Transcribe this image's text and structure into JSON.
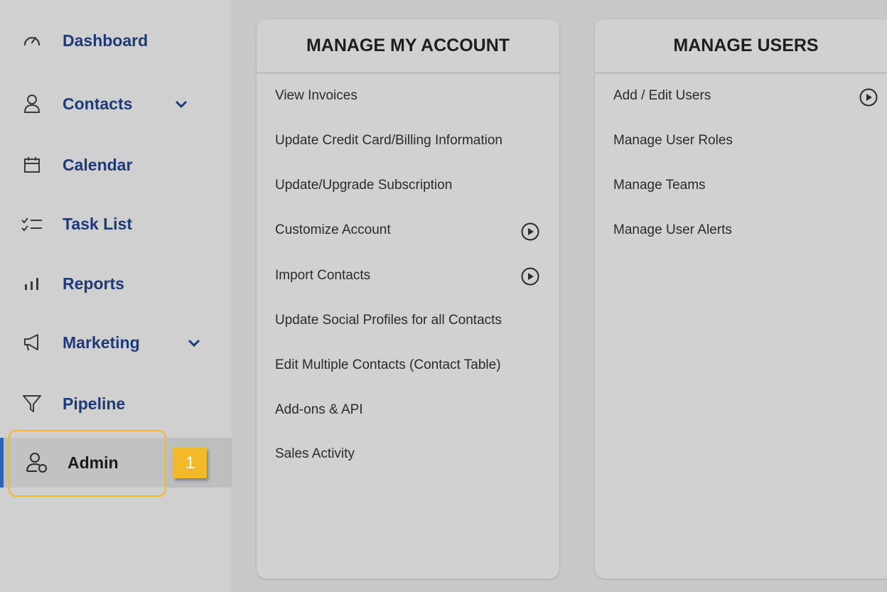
{
  "sidebar": {
    "items": [
      {
        "label": "Dashboard",
        "icon": "gauge-icon"
      },
      {
        "label": "Contacts",
        "icon": "person-icon",
        "has_dropdown": true
      },
      {
        "label": "Calendar",
        "icon": "calendar-icon"
      },
      {
        "label": "Task List",
        "icon": "checklist-icon"
      },
      {
        "label": "Reports",
        "icon": "bar-chart-icon"
      },
      {
        "label": "Marketing",
        "icon": "megaphone-icon",
        "has_dropdown": true
      },
      {
        "label": "Pipeline",
        "icon": "funnel-icon"
      },
      {
        "label": "Admin",
        "icon": "user-shield-icon",
        "active": true
      }
    ]
  },
  "step_badge": "1",
  "cards": {
    "account": {
      "title": "MANAGE MY ACCOUNT",
      "items": [
        {
          "label": "View Invoices"
        },
        {
          "label": "Update Credit Card/Billing Information"
        },
        {
          "label": "Update/Upgrade Subscription"
        },
        {
          "label": "Customize Account",
          "video": true
        },
        {
          "label": "Import Contacts",
          "video": true
        },
        {
          "label": "Update Social Profiles for all Contacts"
        },
        {
          "label": "Edit Multiple Contacts (Contact Table)"
        },
        {
          "label": "Add-ons & API"
        },
        {
          "label": "Sales Activity"
        }
      ]
    },
    "users": {
      "title": "MANAGE USERS",
      "items": [
        {
          "label": "Add / Edit Users",
          "video": true
        },
        {
          "label": "Manage User Roles"
        },
        {
          "label": "Manage Teams"
        },
        {
          "label": "Manage User Alerts"
        }
      ]
    }
  },
  "colors": {
    "nav_text": "#1f3a78",
    "highlight": "#f0b82a",
    "active_bar": "#2a63b8"
  }
}
